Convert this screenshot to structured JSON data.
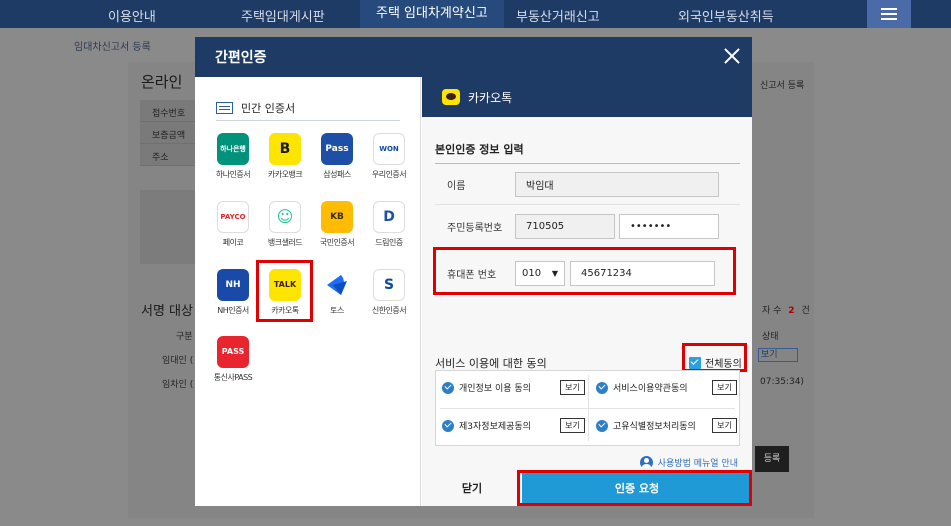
{
  "topnav": {
    "items": [
      "이용안내",
      "주택임대게시판",
      "주택 임대차계약신고",
      "부동산거래신고",
      "외국인부동산취득"
    ],
    "active_index": 2
  },
  "background": {
    "breadcrumb": "임대차신고서 등록",
    "online_title": "온라인",
    "rows": [
      "접수번호",
      "보증금액",
      "주소"
    ],
    "right_label": "신고서 등록",
    "sign_title": "서명 대상",
    "count_label": "자 수",
    "count_value": "2",
    "count_unit": "건",
    "gubun": "구분",
    "roles": [
      "임대인 (",
      "임차인 ("
    ],
    "status_col": "상태",
    "time": "07:35:34)",
    "view_label": "보기",
    "register_label": "등록"
  },
  "modal": {
    "title": "간편인증",
    "left_title": "민간 인증서",
    "providers": [
      {
        "label": "하나인증서",
        "logo_text": "하나은행",
        "color": "#00927b"
      },
      {
        "label": "카카오뱅크",
        "logo_text": "B",
        "color": "#fee500"
      },
      {
        "label": "삼성패스",
        "logo_text": "Pass",
        "color": "#1c4fa5"
      },
      {
        "label": "우리인증서",
        "logo_text": "WON",
        "color": "#ffffff"
      },
      {
        "label": "페이코",
        "logo_text": "PAYCO",
        "color": "#ffffff"
      },
      {
        "label": "뱅크샐러드",
        "logo_text": "☺",
        "color": "#ffffff"
      },
      {
        "label": "국민인증서",
        "logo_text": "KB",
        "color": "#ffbc00"
      },
      {
        "label": "드림인증",
        "logo_text": "D",
        "color": "#ffffff"
      },
      {
        "label": "NH인증서",
        "logo_text": "NH",
        "color": "#1a4aa8"
      },
      {
        "label": "카카오톡",
        "logo_text": "TALK",
        "color": "#fee500"
      },
      {
        "label": "토스",
        "logo_text": "",
        "color": "#ffffff"
      },
      {
        "label": "신한인증서",
        "logo_text": "S",
        "color": "#ffffff"
      },
      {
        "label": "통신사PASS",
        "logo_text": "PASS",
        "color": "#e8242e"
      }
    ],
    "right_title": "카카오톡",
    "form_title": "본인인증 정보 입력",
    "name_label": "이름",
    "name_value": "박임대",
    "rrn_label": "주민등록번호",
    "rrn_front": "710505",
    "rrn_back": "•••••••",
    "phone_label": "휴대폰 번호",
    "phone_prefix": "010",
    "phone_number": "45671234",
    "agree_title": "서비스 이용에 대한 동의",
    "agree_all": "전체동의",
    "agreements": [
      "개인정보 이용 동의",
      "서비스이용약관동의",
      "제3자정보제공동의",
      "고유식별정보처리동의"
    ],
    "view_label": "보기",
    "manual_link": "사용방법 메뉴얼 안내",
    "close_button": "닫기",
    "request_button": "인증 요청"
  },
  "colors": {
    "nav": "#1e3b66",
    "accent": "#1f9ad6",
    "highlight": "#e00000"
  }
}
